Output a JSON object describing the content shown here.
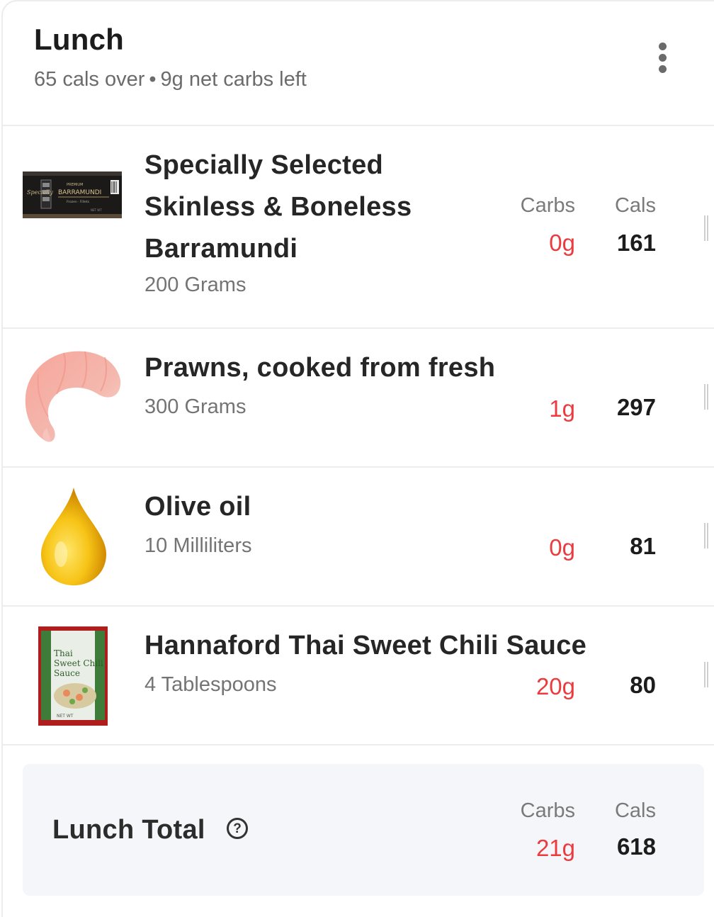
{
  "meal": {
    "title": "Lunch",
    "summary_over": "65 cals over",
    "summary_sep": "•",
    "summary_carbs": "9g net carbs left"
  },
  "columns": {
    "carbs_label": "Carbs",
    "cals_label": "Cals"
  },
  "foods": [
    {
      "name": "Specially Selected Skinless & Boneless Barramundi",
      "name_lines": [
        "Specially Selected",
        "Skinless & Boneless",
        "Barramundi"
      ],
      "serving": "200 Grams",
      "carbs": "0g",
      "cals": "161",
      "thumb_icon": "fish-package-icon",
      "package_text": "BARRAMUNDI"
    },
    {
      "name": "Prawns, cooked from fresh",
      "serving": "300 Grams",
      "carbs": "1g",
      "cals": "297",
      "thumb_icon": "prawn-icon"
    },
    {
      "name": "Olive oil",
      "serving": "10 Milliliters",
      "carbs": "0g",
      "cals": "81",
      "thumb_icon": "oil-drop-icon"
    },
    {
      "name": "Hannaford Thai Sweet Chili Sauce",
      "serving": "4 Tablespoons",
      "carbs": "20g",
      "cals": "80",
      "thumb_icon": "sauce-jar-icon",
      "package_text": "Thai Sweet Chili Sauce"
    }
  ],
  "total": {
    "label": "Lunch Total",
    "help_glyph": "?",
    "carbs_label": "Carbs",
    "cals_label": "Cals",
    "carbs": "21g",
    "cals": "618"
  },
  "colors": {
    "carbs_red": "#ec3b3f",
    "divider": "#ececec",
    "total_bg": "#f5f6f9"
  }
}
